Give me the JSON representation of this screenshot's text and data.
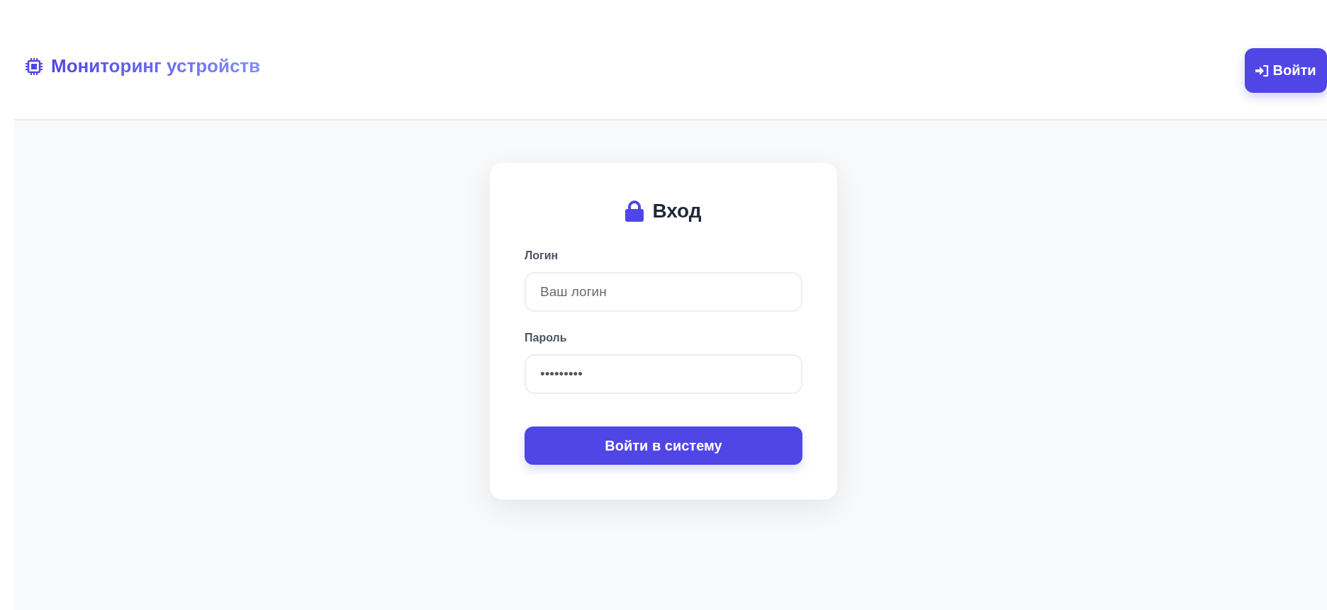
{
  "header": {
    "title": "Мониторинг устройств",
    "login_button": "Войти"
  },
  "login_card": {
    "title": "Вход",
    "fields": [
      {
        "label": "Логин",
        "placeholder": "Ваш логин"
      },
      {
        "label": "Пароль",
        "value": "•••••••••"
      }
    ],
    "submit": "Войти в систему"
  }
}
